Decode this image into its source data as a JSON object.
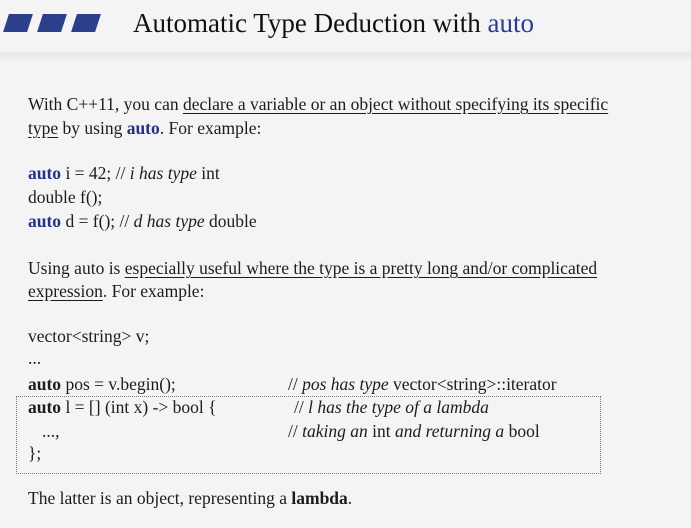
{
  "title": {
    "main": "Automatic Type Deduction with ",
    "keyword": "auto"
  },
  "intro": {
    "line1_pre": "With C++11, you can ",
    "line1_u": "declare a variable or an object without specifying its specific",
    "line2_u": "type",
    "line2_mid": " by using ",
    "line2_kw": "auto",
    "line2_post": ". For example:"
  },
  "example1": {
    "l1_kw": "auto",
    "l1_code": " i = 42; // ",
    "l1_comment": "i has type",
    "l1_type": " int",
    "l2_code": "double f();",
    "l3_kw": "auto",
    "l3_code": " d = f(); // ",
    "l3_comment": "d has type",
    "l3_type": " double"
  },
  "usage": {
    "line1_pre": "Using auto is ",
    "line1_u": "especially useful where the type is a pretty long and/or complicated",
    "line2_u": "expression",
    "line2_post": ". For example:"
  },
  "example2": {
    "l1": "vector<string> v;",
    "l2": "...",
    "l3_kw": "auto",
    "l3_code": " pos = v.begin();",
    "l3_c_pre": "// ",
    "l3_c_it": "pos has type",
    "l3_c_post": " vector<string>::iterator",
    "l4_kw": "auto",
    "l4_code": " l = [] (int x) -> bool {",
    "l4_c_pre": "// ",
    "l4_c_it": "l has the type of a lambda",
    "l5_code": "...,",
    "l5_c_pre": "// ",
    "l5_c_it1": "taking an",
    "l5_c_mid": " int ",
    "l5_c_it2": "and returning a",
    "l5_c_post": " bool",
    "l6_code": "};"
  },
  "conclusion": {
    "pre": "The latter is an object, representing a ",
    "kw": "lambda",
    "post": "."
  }
}
